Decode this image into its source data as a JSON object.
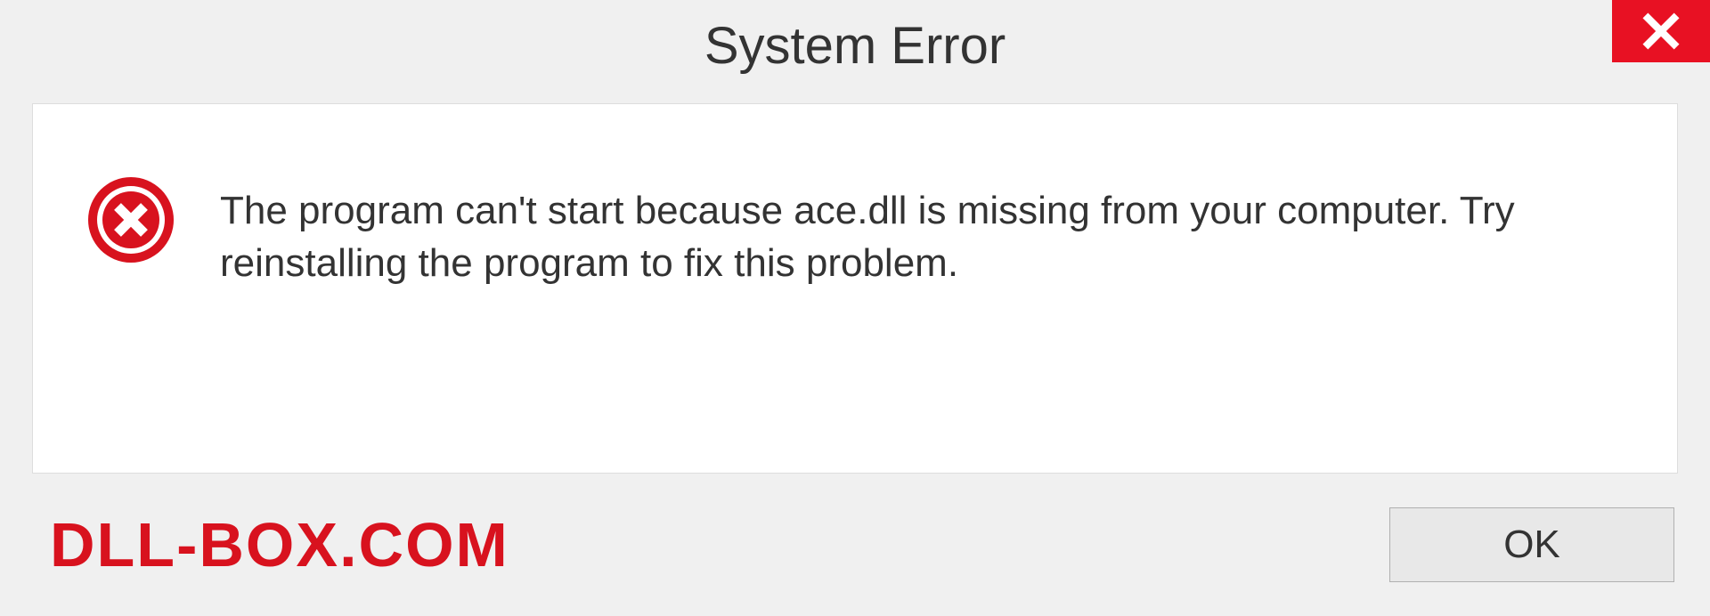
{
  "window": {
    "title": "System Error"
  },
  "message": {
    "text": "The program can't start because ace.dll is missing from your computer. Try reinstalling the program to fix this problem."
  },
  "footer": {
    "watermark": "DLL-BOX.COM",
    "ok_label": "OK"
  },
  "icons": {
    "close": "close-icon",
    "error": "error-icon"
  },
  "colors": {
    "close_bg": "#e81123",
    "error_icon": "#d8121e",
    "watermark": "#d8121e"
  }
}
